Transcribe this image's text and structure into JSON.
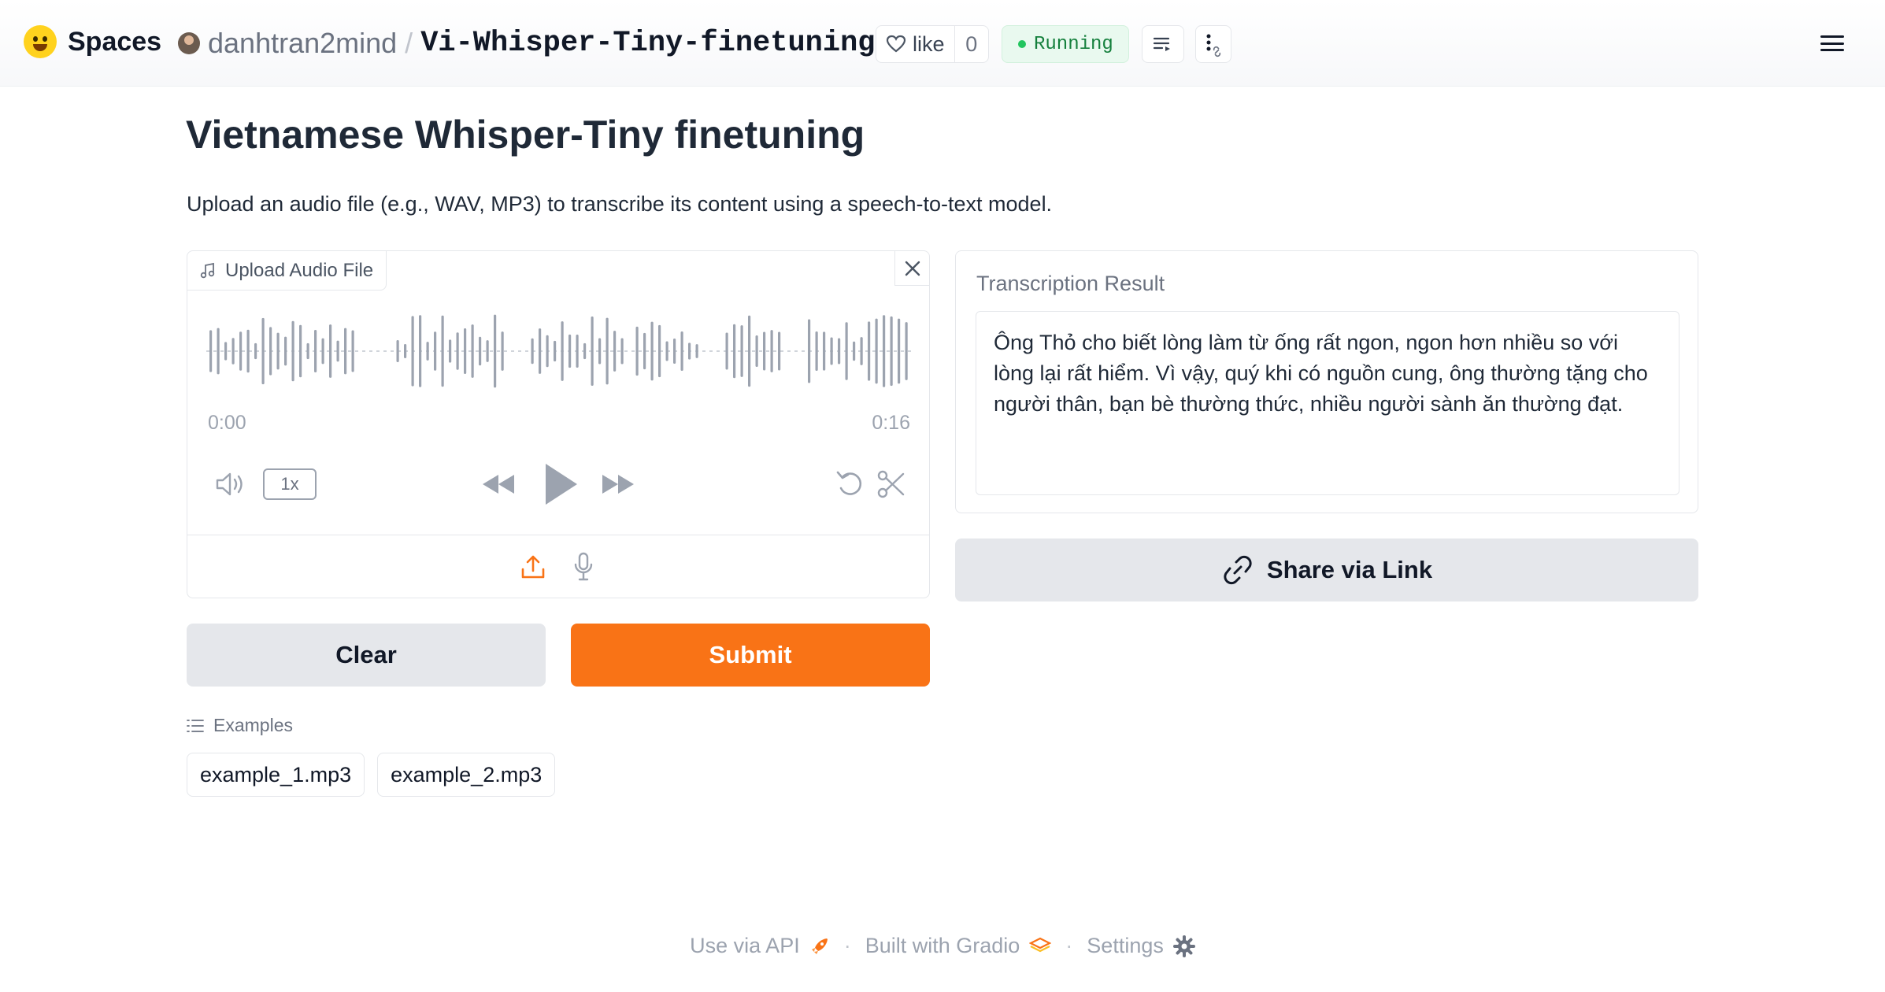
{
  "header": {
    "brand": "Spaces",
    "owner": "danhtran2mind",
    "separator": "/",
    "repo": "Vi-Whisper-Tiny-finetuning",
    "like_label": "like",
    "like_count": "0",
    "status": "Running"
  },
  "main": {
    "title": "Vietnamese Whisper-Tiny finetuning",
    "description": "Upload an audio file (e.g., WAV, MP3) to transcribe its content using a speech-to-text model."
  },
  "audio": {
    "label": "Upload Audio File",
    "time_start": "0:00",
    "time_end": "0:16",
    "speed": "1x"
  },
  "result": {
    "label": "Transcription Result",
    "text": " Ông Thỏ cho biết lòng làm từ ống rất ngon, ngon hơn nhiều so với lòng lại rất hiểm. Vì vậy, quý khi có nguồn cung, ông thường tặng cho người thân, bạn bè thường thức, nhiều người sành ăn thường đạt."
  },
  "actions": {
    "share_label": "Share via Link",
    "clear_label": "Clear",
    "submit_label": "Submit"
  },
  "examples": {
    "header": "Examples",
    "items": [
      "example_1.mp3",
      "example_2.mp3"
    ]
  },
  "footer": {
    "api": "Use via API",
    "gradio": "Built with Gradio",
    "settings": "Settings",
    "separator": "·"
  },
  "colors": {
    "accent": "#f97316",
    "status_green": "#22c55e",
    "button_gray": "#e5e7eb"
  },
  "icons": [
    "hugging-face-emoji-icon",
    "copy-icon",
    "heart-icon",
    "queue-icon",
    "more-vertical-icon",
    "link-icon",
    "hamburger-menu-icon",
    "music-note-icon",
    "close-icon",
    "volume-icon",
    "rewind-icon",
    "play-icon",
    "fast-forward-icon",
    "undo-icon",
    "scissors-icon",
    "upload-icon",
    "microphone-icon",
    "list-icon",
    "rocket-icon",
    "gradio-logo-icon",
    "gear-icon"
  ]
}
